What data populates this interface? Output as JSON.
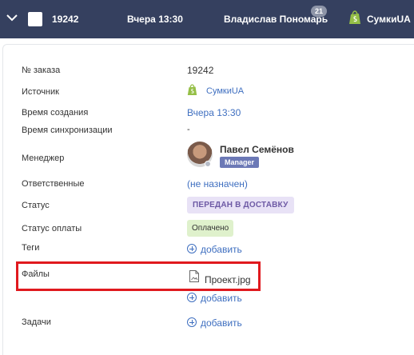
{
  "header": {
    "order_number": "19242",
    "time": "Вчера 13:30",
    "user": "Владислав Пономарь",
    "notification_count": "21",
    "shop": "СумкиUA",
    "bg_color": "#35405f"
  },
  "fields": {
    "order_label": "№ заказа",
    "order_value": "19242",
    "source_label": "Источник",
    "source_value": "СумкиUA",
    "created_label": "Время создания",
    "created_value": "Вчера 13:30",
    "sync_label": "Время синхронизации",
    "sync_value": "-",
    "manager_label": "Менеджер",
    "manager_name": "Павел Семёнов",
    "manager_role": "Manager",
    "responsible_label": "Ответственные",
    "responsible_value": "(не назначен)",
    "status_label": "Статус",
    "status_value": "ПЕРЕДАН В ДОСТАВКУ",
    "payment_label": "Статус оплаты",
    "payment_value": "Оплачено",
    "tags_label": "Теги",
    "tags_add": "добавить",
    "files_label": "Файлы",
    "file_name": "Проект.jpg",
    "files_add": "добавить",
    "tasks_label": "Задачи",
    "tasks_add": "добавить"
  },
  "colors": {
    "link": "#3f6fc0",
    "status_bg": "#e8e2f6",
    "payment_bg": "#dff1cc",
    "highlight": "#e0191e"
  },
  "icons": {
    "collapse": "chevron-down-icon",
    "select": "checkbox-icon",
    "shop": "shopify-bag-icon",
    "file": "image-file-icon",
    "add": "plus-circle-icon"
  }
}
